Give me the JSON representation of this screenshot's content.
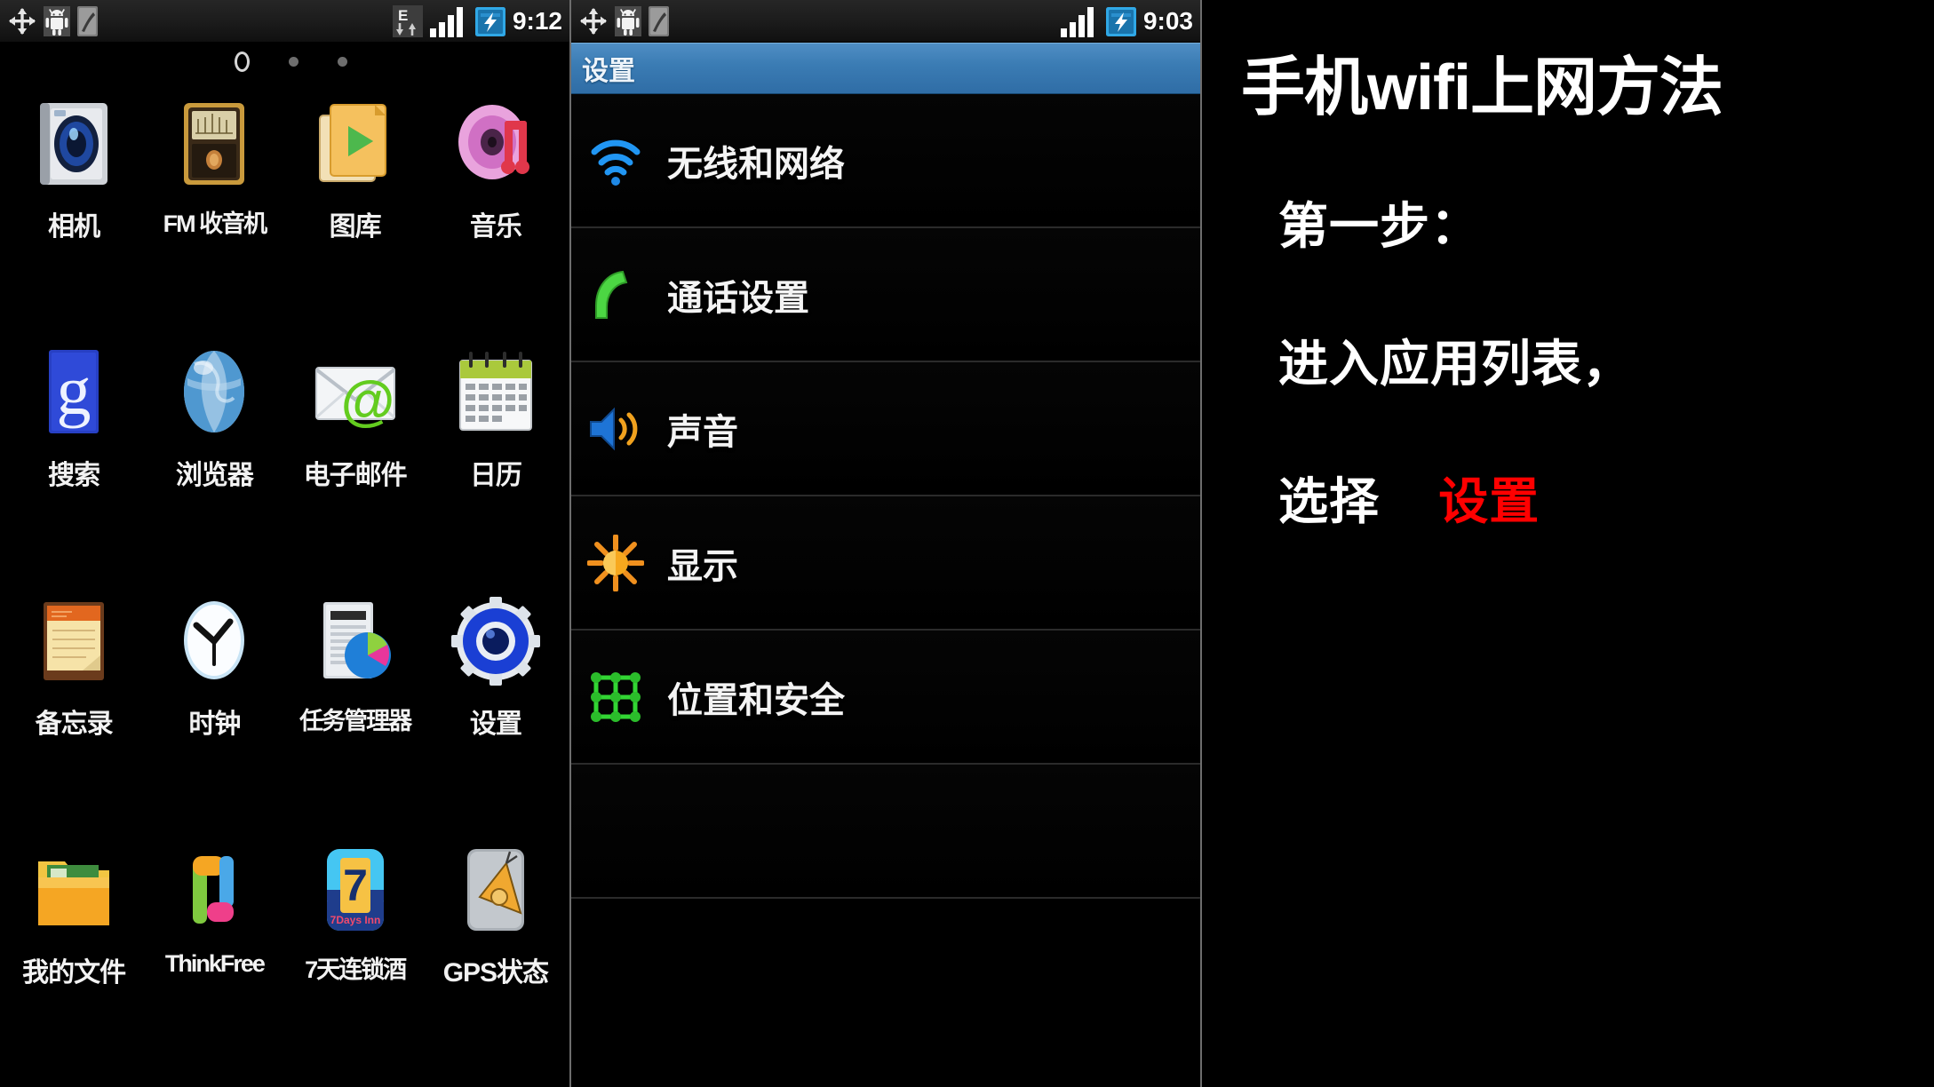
{
  "home": {
    "statusbar": {
      "icons": [
        "usb-transfer-icon",
        "android-robot-icon",
        "sd-card-icon"
      ],
      "network_type": "E",
      "signal_icon": "signal-bars-icon",
      "battery_icon": "battery-charging-icon",
      "clock": "9:12"
    },
    "page_indicator": {
      "current": "1",
      "total": 3
    },
    "apps": [
      {
        "label": "相机",
        "icon": "camera-icon"
      },
      {
        "label": "FM 收音机",
        "icon": "fm-radio-icon"
      },
      {
        "label": "图库",
        "icon": "gallery-icon"
      },
      {
        "label": "音乐",
        "icon": "music-icon"
      },
      {
        "label": "搜索",
        "icon": "google-search-icon"
      },
      {
        "label": "浏览器",
        "icon": "browser-globe-icon"
      },
      {
        "label": "电子邮件",
        "icon": "email-icon"
      },
      {
        "label": "日历",
        "icon": "calendar-icon"
      },
      {
        "label": "备忘录",
        "icon": "memo-icon"
      },
      {
        "label": "时钟",
        "icon": "clock-icon"
      },
      {
        "label": "任务管理器",
        "icon": "task-manager-icon"
      },
      {
        "label": "设置",
        "icon": "settings-gear-icon"
      },
      {
        "label": "我的文件",
        "icon": "my-files-folder-icon"
      },
      {
        "label": "ThinkFree",
        "icon": "thinkfree-icon"
      },
      {
        "label": "7天连锁酒",
        "icon": "7days-inn-icon"
      },
      {
        "label": "GPS状态",
        "icon": "gps-status-icon"
      }
    ]
  },
  "settings": {
    "statusbar": {
      "icons": [
        "usb-transfer-icon",
        "android-robot-icon",
        "sd-card-icon"
      ],
      "signal_icon": "signal-bars-icon",
      "battery_icon": "battery-charging-icon",
      "clock": "9:03"
    },
    "header_title": "设置",
    "items": [
      {
        "label": "无线和网络",
        "icon": "wifi-icon"
      },
      {
        "label": "通话设置",
        "icon": "phone-call-icon"
      },
      {
        "label": "声音",
        "icon": "sound-speaker-icon"
      },
      {
        "label": "显示",
        "icon": "display-brightness-icon"
      },
      {
        "label": "位置和安全",
        "icon": "location-security-icon"
      }
    ]
  },
  "caption": {
    "title": "手机wifi上网方法",
    "step_label": "第一步：",
    "instruction": "进入应用列表，",
    "action_prefix": "选择",
    "action_target": "设置",
    "highlight_color": "#ff0000"
  }
}
